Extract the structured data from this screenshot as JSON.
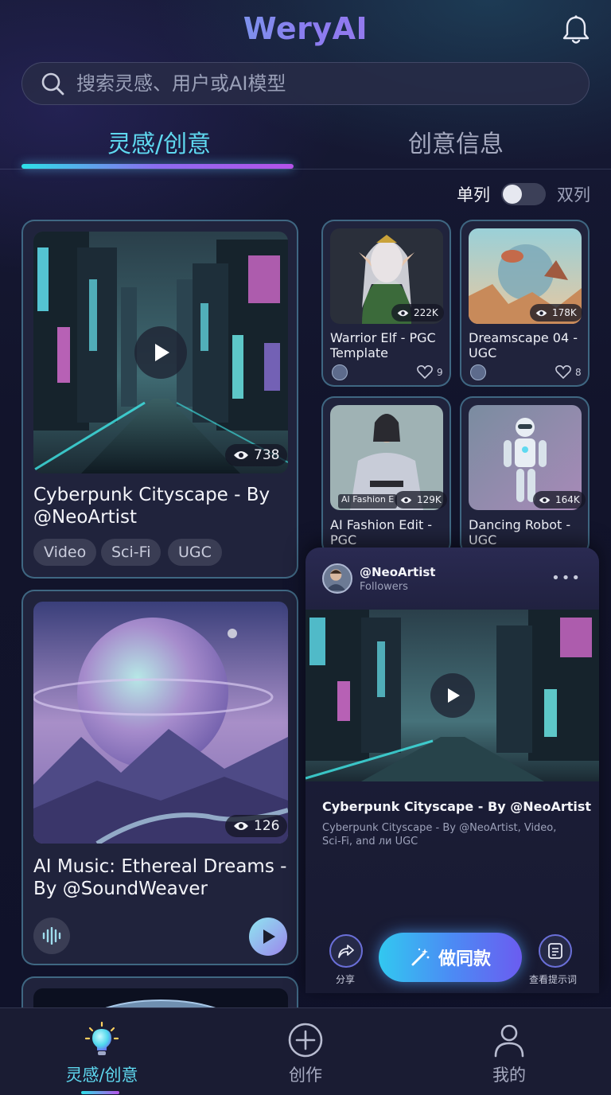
{
  "app": {
    "logo": "WeryAI"
  },
  "header": {
    "bell_icon": "bell-icon"
  },
  "search": {
    "placeholder": "搜索灵感、用户或AI模型",
    "icon": "search-icon"
  },
  "tabs": [
    {
      "label": "灵感/创意",
      "active": true
    },
    {
      "label": "创意信息",
      "active": false
    }
  ],
  "layout_toggle": {
    "left_label": "单列",
    "right_label": "双列",
    "state": "off"
  },
  "feed": {
    "card1": {
      "views": "738",
      "title_line1": "Cyberpunk Cityscape - By",
      "title_line2": "@NeoArtist",
      "tags": [
        "Video",
        "Sci-Fi",
        "UGC"
      ]
    },
    "card2": {
      "views": "126",
      "title_line1": "AI Music: Ethereal Dreams -",
      "title_line2": "By @SoundWeaver"
    },
    "small_cards": [
      {
        "views": "222K",
        "title_line1": "Warrior Elf - PGC",
        "title_line2": "Template",
        "likes": "9"
      },
      {
        "views": "178K",
        "title_line1": "Dreamscape 04 -",
        "title_line2": "UGC",
        "likes": "8"
      },
      {
        "views": "129K",
        "overlay": "AI Fashion E",
        "title_line1": "AI Fashion Edit -",
        "title_line2": "PGC"
      },
      {
        "views": "164K",
        "title_line1": "Dancing Robot -",
        "title_line2": "UGC"
      }
    ]
  },
  "popup": {
    "username": "@NeoArtist",
    "followers_label": "Followers",
    "more": "•••",
    "title": "Cyberpunk Cityscape - By @NeoArtist",
    "description": "Cyberpunk Cityscape - By @NeoArtist, Video, Sci-Fi, and ли UGC",
    "share_label": "分享",
    "make_label": "做同款",
    "prompt_label": "查看提示词"
  },
  "bottom_nav": [
    {
      "label": "灵感/创意",
      "icon": "lightbulb-icon",
      "active": true
    },
    {
      "label": "创作",
      "icon": "plus-circle-icon",
      "active": false
    },
    {
      "label": "我的",
      "icon": "user-icon",
      "active": false
    }
  ],
  "colors": {
    "accent_cyan": "#5fd9f0",
    "accent_purple": "#b552e8",
    "background": "#12142a"
  }
}
